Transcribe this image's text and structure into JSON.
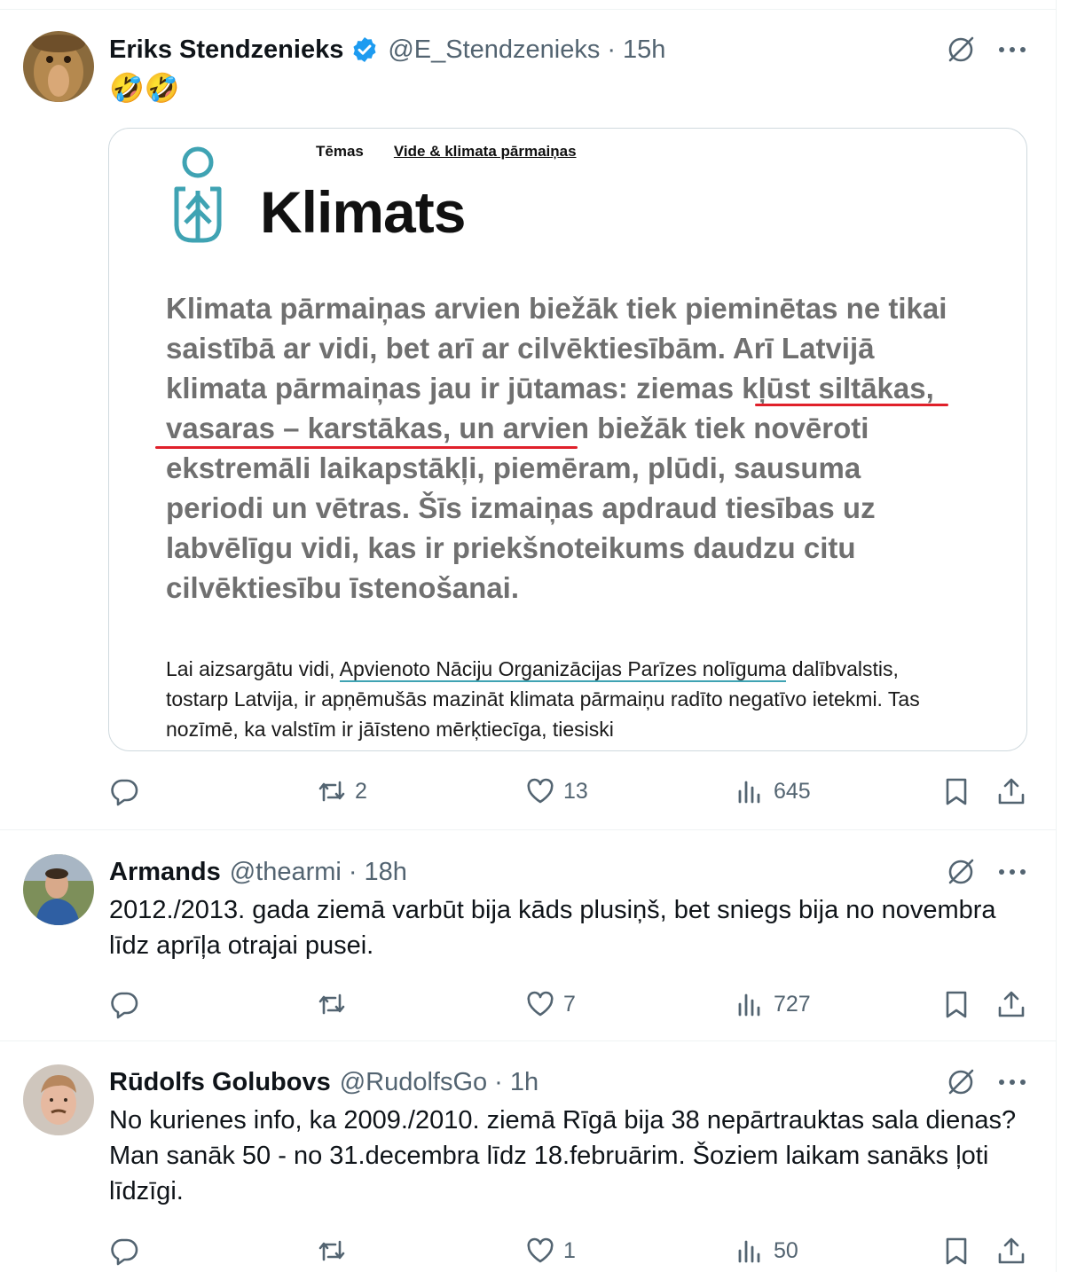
{
  "tweets": [
    {
      "name": "Eriks Stendzenieks",
      "verified": true,
      "handle": "@E_Stendzenieks",
      "separator": "·",
      "time": "15h",
      "text": "🤣🤣",
      "card": {
        "crumb_1": "Tēmas",
        "crumb_2": "Vide & klimata pārmaiņas",
        "title": "Klimats",
        "lead_before": "Klimata pārmaiņas arvien biežāk tiek pieminētas ne tikai saistībā ar vidi, bet arī ar cilvēktiesībām. Arī Latvijā klimata pārmaiņas jau ir jūtamas: ",
        "lead_highlight": "ziemas kļūst siltākas, vasaras – karstākas,",
        "lead_after": " un arvien biežāk tiek novēroti ekstremāli laikapstākļi, piemēram, plūdi, sausuma periodi un vētras. Šīs izmaiņas apdraud tiesības uz labvēlīgu vidi, kas ir priekšnoteikums daudzu citu cilvēktiesību īstenošanai.",
        "para_before": "Lai aizsargātu vidi, ",
        "para_link": "Apvienoto Nāciju Organizācijas Parīzes nolīguma",
        "para_after": " dalībvalstis, tostarp Latvija, ir apņēmušās mazināt klimata pārmaiņu radīto negatīvo ietekmi. Tas nozīmē, ka valstīm ir jāīsteno mērķtiecīga, tiesiski"
      },
      "replies": "",
      "retweets": "2",
      "likes": "13",
      "views": "645"
    },
    {
      "name": "Armands",
      "verified": false,
      "handle": "@thearmi",
      "separator": "·",
      "time": "18h",
      "text": "2012./2013. gada ziemā varbūt bija kāds plusiņš, bet sniegs bija no novembra līdz aprīļa otrajai pusei.",
      "replies": "",
      "retweets": "",
      "likes": "7",
      "views": "727"
    },
    {
      "name": "Rūdolfs Golubovs",
      "verified": false,
      "handle": "@RudolfsGo",
      "separator": "·",
      "time": "1h",
      "text": "No kurienes info, ka 2009./2010. ziemā Rīgā bija 38 nepārtrauktas sala dienas? Man sanāk 50 - no 31.decembra līdz 18.februārim. Šoziem laikam sanāks ļoti līdzīgi.",
      "replies": "",
      "retweets": "",
      "likes": "1",
      "views": "50"
    }
  ],
  "colors": {
    "text": "#0f1419",
    "muted": "#536471",
    "border": "#eff3f4",
    "verified": "#1d9bf0",
    "logo": "#3fa3b3",
    "underline": "#e0202a"
  },
  "icons": [
    "verified-badge-icon",
    "grok-icon",
    "more-icon",
    "reply-icon",
    "retweet-icon",
    "like-icon",
    "views-icon",
    "bookmark-icon",
    "share-icon"
  ]
}
